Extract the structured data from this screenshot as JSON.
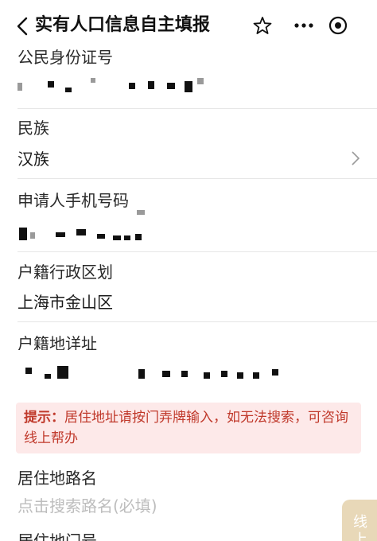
{
  "header": {
    "title": "实有人口信息自主填报"
  },
  "form": {
    "id_card": {
      "label": "公民身份证号"
    },
    "ethnicity": {
      "label": "民族",
      "value": "汉族"
    },
    "phone": {
      "label": "申请人手机号码"
    },
    "household_region": {
      "label": "户籍行政区划",
      "value": "上海市金山区"
    },
    "household_address": {
      "label": "户籍地详址"
    },
    "notice": {
      "prefix": "提示：",
      "text": "居住地址请按门弄牌输入，如无法搜索，可咨询线上帮办"
    },
    "residence_road": {
      "label": "居住地路名",
      "placeholder": "点击搜索路名(必填)"
    },
    "next_field": {
      "label": "居住地门号"
    }
  },
  "help_tab": {
    "label": "线上"
  },
  "colors": {
    "notice_bg": "#fde9e9",
    "notice_text": "#c0392b",
    "placeholder": "#bdbdbd",
    "help_tab": "#e8d8b8"
  },
  "icons": {
    "back": "chevron-left-icon",
    "favorite": "star-icon",
    "more": "more-dots-icon",
    "record": "target-circle-icon",
    "select": "chevron-right-icon"
  }
}
